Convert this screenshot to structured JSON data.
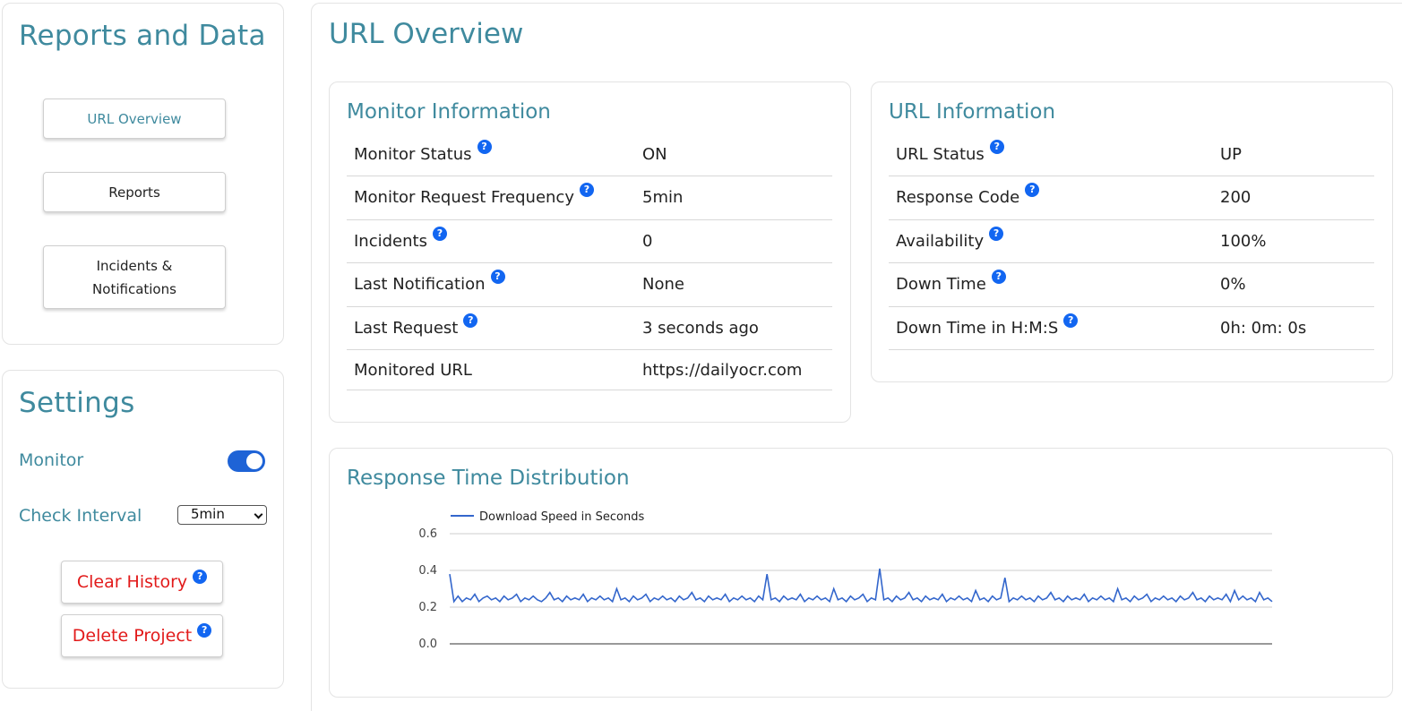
{
  "sidebar": {
    "reports_title": "Reports and Data",
    "nav": [
      {
        "label": "URL Overview"
      },
      {
        "label": "Reports"
      },
      {
        "label": "Incidents & Notifications"
      }
    ],
    "settings_title": "Settings",
    "monitor_label": "Monitor",
    "monitor_on": true,
    "check_interval_label": "Check Interval",
    "check_interval_value": "5min",
    "clear_history_label": "Clear History",
    "delete_project_label": "Delete Project"
  },
  "main": {
    "title": "URL Overview",
    "monitor_info": {
      "title": "Monitor Information",
      "rows": [
        {
          "label": "Monitor Status",
          "value": "ON"
        },
        {
          "label": "Monitor Request Frequency",
          "value": "5min"
        },
        {
          "label": "Incidents",
          "value": "0"
        },
        {
          "label": "Last Notification",
          "value": "None"
        },
        {
          "label": "Last Request",
          "value": "3 seconds ago"
        },
        {
          "label": "Monitored URL",
          "value": "https://dailyocr.com"
        }
      ]
    },
    "url_info": {
      "title": "URL Information",
      "rows": [
        {
          "label": "URL Status",
          "value": "UP"
        },
        {
          "label": "Response Code",
          "value": "200"
        },
        {
          "label": "Availability",
          "value": "100%"
        },
        {
          "label": "Down Time",
          "value": "0%"
        },
        {
          "label": "Down Time in H:M:S",
          "value": "0h: 0m: 0s"
        }
      ]
    },
    "response_title": "Response Time Distribution"
  },
  "help_glyph": "?",
  "colors": {
    "accent": "#3f8a9e",
    "danger": "#e21a1a",
    "toggle": "#1e63d6",
    "help": "#1266f1",
    "series": "#3366cc"
  },
  "chart_data": {
    "type": "line",
    "title": "",
    "legend": "top-left",
    "series": [
      {
        "name": "Download Speed in Seconds",
        "values": [
          0.38,
          0.23,
          0.26,
          0.23,
          0.25,
          0.24,
          0.27,
          0.23,
          0.25,
          0.26,
          0.24,
          0.25,
          0.23,
          0.26,
          0.24,
          0.25,
          0.27,
          0.23,
          0.25,
          0.24,
          0.26,
          0.24,
          0.23,
          0.25,
          0.28,
          0.24,
          0.25,
          0.23,
          0.26,
          0.24,
          0.25,
          0.24,
          0.27,
          0.23,
          0.25,
          0.24,
          0.26,
          0.24,
          0.25,
          0.23,
          0.3,
          0.24,
          0.25,
          0.23,
          0.26,
          0.24,
          0.25,
          0.27,
          0.23,
          0.25,
          0.24,
          0.26,
          0.24,
          0.25,
          0.23,
          0.26,
          0.24,
          0.25,
          0.28,
          0.24,
          0.25,
          0.23,
          0.26,
          0.24,
          0.25,
          0.24,
          0.27,
          0.23,
          0.25,
          0.24,
          0.26,
          0.24,
          0.25,
          0.23,
          0.26,
          0.24,
          0.38,
          0.24,
          0.25,
          0.23,
          0.26,
          0.24,
          0.25,
          0.24,
          0.27,
          0.23,
          0.25,
          0.24,
          0.26,
          0.24,
          0.25,
          0.23,
          0.3,
          0.24,
          0.25,
          0.23,
          0.26,
          0.24,
          0.25,
          0.27,
          0.23,
          0.25,
          0.24,
          0.41,
          0.24,
          0.25,
          0.23,
          0.26,
          0.24,
          0.25,
          0.28,
          0.24,
          0.25,
          0.23,
          0.26,
          0.24,
          0.25,
          0.24,
          0.27,
          0.23,
          0.25,
          0.24,
          0.26,
          0.24,
          0.25,
          0.23,
          0.29,
          0.24,
          0.25,
          0.23,
          0.26,
          0.24,
          0.25,
          0.36,
          0.23,
          0.25,
          0.24,
          0.26,
          0.24,
          0.25,
          0.23,
          0.26,
          0.24,
          0.25,
          0.28,
          0.24,
          0.25,
          0.23,
          0.26,
          0.24,
          0.25,
          0.24,
          0.27,
          0.23,
          0.25,
          0.24,
          0.26,
          0.24,
          0.25,
          0.23,
          0.3,
          0.24,
          0.25,
          0.23,
          0.26,
          0.24,
          0.25,
          0.27,
          0.23,
          0.25,
          0.24,
          0.26,
          0.24,
          0.25,
          0.23,
          0.26,
          0.24,
          0.25,
          0.28,
          0.24,
          0.25,
          0.23,
          0.26,
          0.24,
          0.25,
          0.24,
          0.27,
          0.23,
          0.29,
          0.24,
          0.26,
          0.24,
          0.25,
          0.23,
          0.28,
          0.24,
          0.25,
          0.23
        ]
      }
    ],
    "x_count": 198,
    "xlabel": "",
    "ylabel": "",
    "y_ticks": [
      "0.0",
      "0.2",
      "0.4",
      "0.6"
    ],
    "ylim": [
      0,
      0.6
    ],
    "grid": true
  }
}
